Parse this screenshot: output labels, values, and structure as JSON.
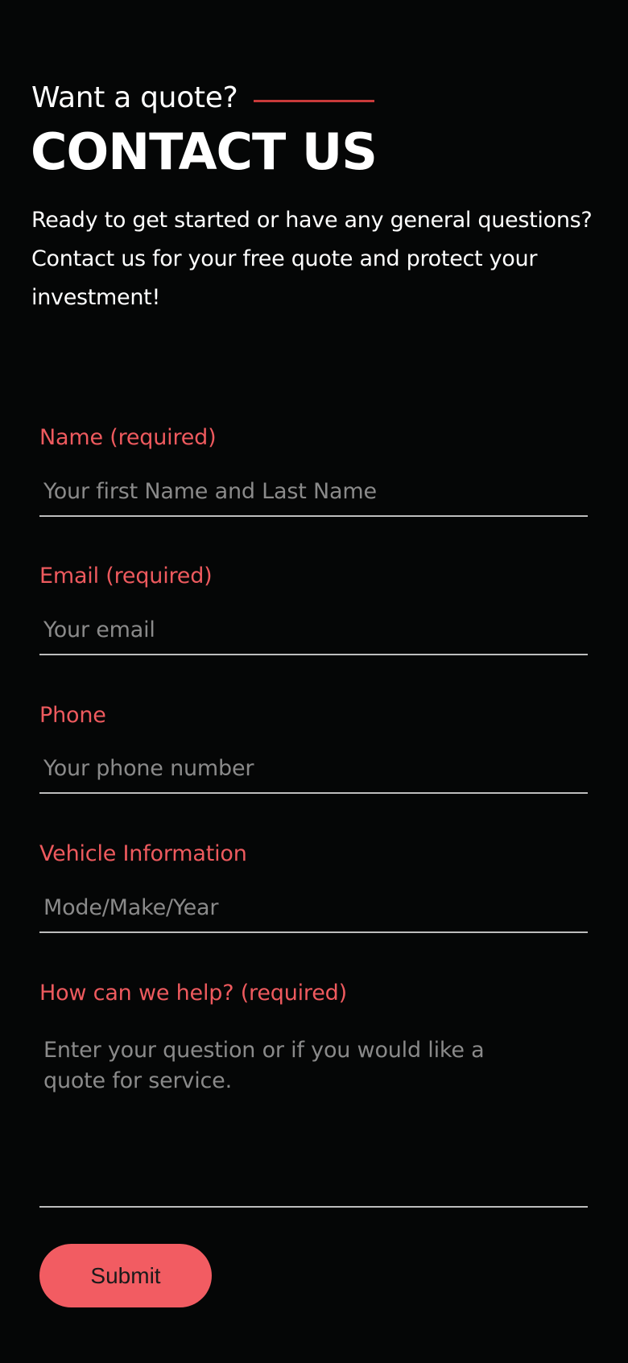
{
  "header": {
    "eyebrow": "Want a quote?",
    "title": "CONTACT US",
    "intro": "Ready to get started or have any general questions? Contact us for your free quote and protect your investment!"
  },
  "form": {
    "name": {
      "label": "Name (required)",
      "placeholder": "Your first Name and Last Name"
    },
    "email": {
      "label": "Email (required)",
      "placeholder": "Your email"
    },
    "phone": {
      "label": "Phone",
      "placeholder": "Your phone number"
    },
    "vehicle": {
      "label": "Vehicle Information",
      "placeholder": "Mode/Make/Year"
    },
    "message": {
      "label": "How can we help? (required)",
      "placeholder": "Enter your question or if you would like a quote for service."
    },
    "submit_label": "Submit"
  },
  "colors": {
    "background": "#050606",
    "accent": "#ee5a5e",
    "button": "#f25c62",
    "divider": "#bdbdbd"
  }
}
